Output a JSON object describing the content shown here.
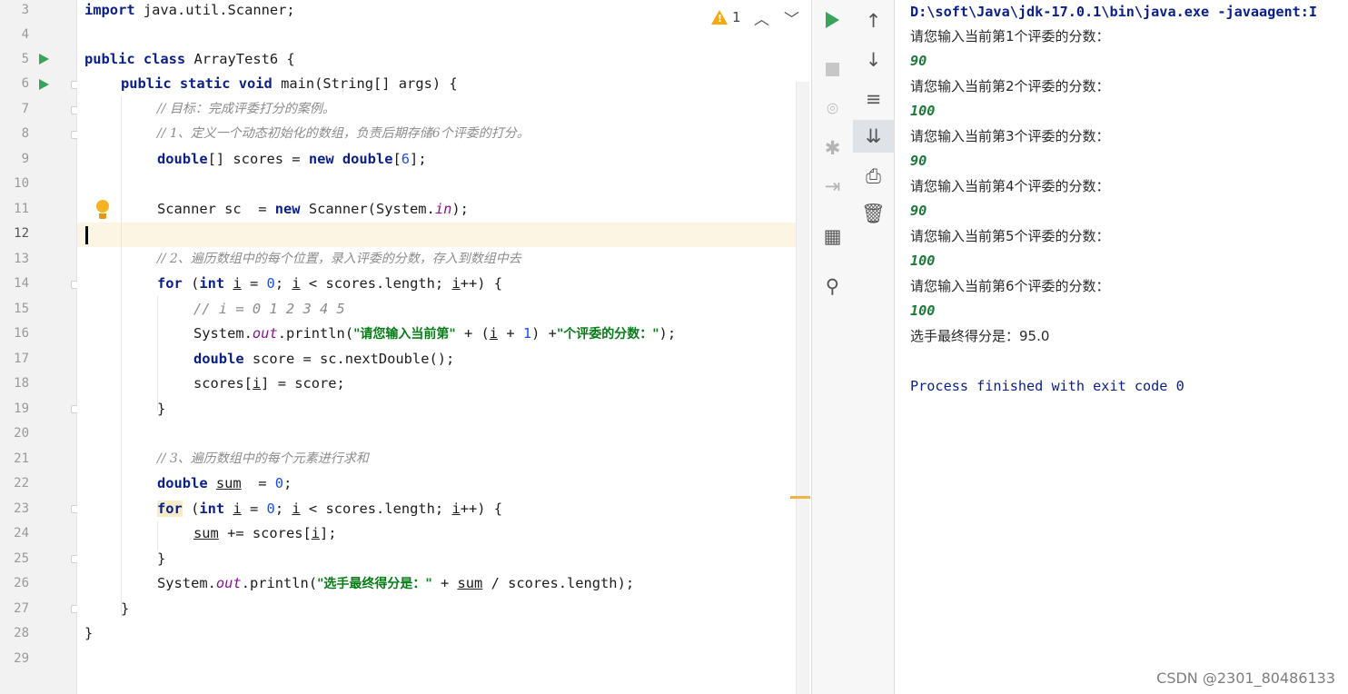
{
  "editor": {
    "line_numbers": [
      "3",
      "4",
      "5",
      "6",
      "7",
      "8",
      "9",
      "10",
      "11",
      "12",
      "13",
      "14",
      "15",
      "16",
      "17",
      "18",
      "19",
      "20",
      "21",
      "22",
      "23",
      "24",
      "25",
      "26",
      "27",
      "28",
      "29"
    ],
    "warning_count": "1",
    "code": {
      "l3_a": "import",
      "l3_b": " java.util.Scanner;",
      "l5_a": "public class",
      "l5_b": " ArrayTest6 {",
      "l6_a": "public static void",
      "l6_b": " main(String[] args) {",
      "l7": "// 目标：完成评委打分的案例。",
      "l8": "// 1、定义一个动态初始化的数组，负责后期存储6个评委的打分。",
      "l9_a": "double",
      "l9_b": "[] scores = ",
      "l9_c": "new double",
      "l9_d": "[",
      "l9_e": "6",
      "l9_f": "];",
      "l11_a": "Scanner sc  = ",
      "l11_b": "new",
      "l11_c": " Scanner(System.",
      "l11_d": "in",
      "l11_e": ");",
      "l13": "// 2、遍历数组中的每个位置，录入评委的分数，存入到数组中去",
      "l14_a": "for",
      "l14_b": " (",
      "l14_c": "int",
      "l14_d": " ",
      "l14_e": "i",
      "l14_f": " = ",
      "l14_g": "0",
      "l14_h": "; ",
      "l14_i": "i",
      "l14_j": " < scores.length; ",
      "l14_k": "i",
      "l14_l": "++) {",
      "l15": "// i = 0 1 2 3 4 5",
      "l16_a": "System.",
      "l16_b": "out",
      "l16_c": ".println(",
      "l16_d": "\"请您输入当前第\"",
      "l16_e": " + (",
      "l16_f": "i",
      "l16_g": " + ",
      "l16_h": "1",
      "l16_i": ") +",
      "l16_j": "\"个评委的分数：\"",
      "l16_k": ");",
      "l17_a": "double",
      "l17_b": " score = sc.nextDouble();",
      "l18_a": "scores[",
      "l18_b": "i",
      "l18_c": "] = score;",
      "l19": "}",
      "l21": "// 3、遍历数组中的每个元素进行求和",
      "l22_a": "double",
      "l22_b": " ",
      "l22_c": "sum",
      "l22_d": "  = ",
      "l22_e": "0",
      "l22_f": ";",
      "l23_a": "for",
      "l23_b": " (",
      "l23_c": "int",
      "l23_d": " ",
      "l23_e": "i",
      "l23_f": " = ",
      "l23_g": "0",
      "l23_h": "; ",
      "l23_i": "i",
      "l23_j": " < scores.length; ",
      "l23_k": "i",
      "l23_l": "++) {",
      "l24_a": "sum",
      "l24_b": " += scores[",
      "l24_c": "i",
      "l24_d": "];",
      "l25": "}",
      "l26_a": "System.",
      "l26_b": "out",
      "l26_c": ".println(",
      "l26_d": "\"选手最终得分是：\"",
      "l26_e": " + ",
      "l26_f": "sum",
      "l26_g": " / scores.length);",
      "l27": "}",
      "l28": "}"
    }
  },
  "toolbar_left": [
    "rerun-icon",
    "stop-icon",
    "camera-icon",
    "debug-icon",
    "exit-icon",
    "layout-icon",
    "pin-icon"
  ],
  "toolbar_right": [
    "up-arrow-icon",
    "down-arrow-icon",
    "soft-wrap-icon",
    "scroll-to-end-icon",
    "print-icon",
    "trash-icon"
  ],
  "console": {
    "command": "D:\\soft\\Java\\jdk-17.0.1\\bin\\java.exe -javaagent:I",
    "prompts": [
      "请您输入当前第1个评委的分数：",
      "请您输入当前第2个评委的分数：",
      "请您输入当前第3个评委的分数：",
      "请您输入当前第4个评委的分数：",
      "请您输入当前第5个评委的分数：",
      "请您输入当前第6个评委的分数："
    ],
    "inputs": [
      "90",
      "100",
      "90",
      "90",
      "100",
      "100"
    ],
    "result": "选手最终得分是：95.0",
    "exit": "Process finished with exit code 0"
  },
  "watermark": "CSDN @2301_80486133",
  "colors": {
    "keyword": "#0a1f8a",
    "string": "#067d17",
    "comment": "#8c8c8c",
    "number": "#1750eb",
    "run_green": "#3aa35a",
    "warning": "#f2a90c",
    "current_line": "#fcf5e3"
  }
}
